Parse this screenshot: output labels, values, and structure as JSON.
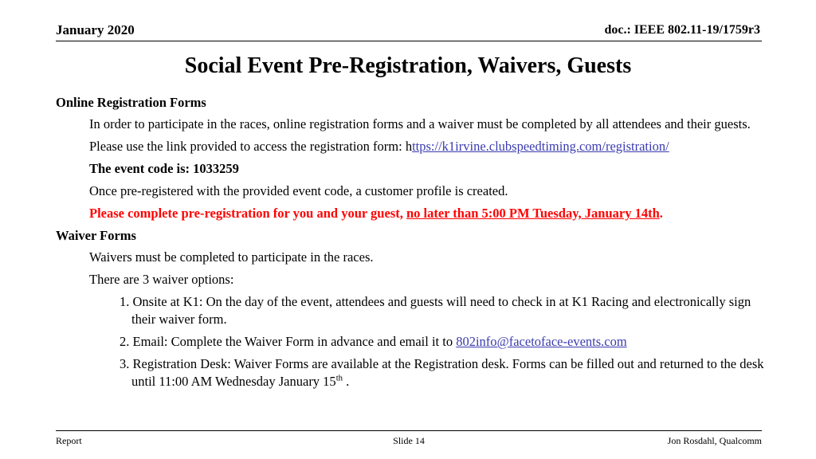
{
  "header": {
    "date": "January 2020",
    "doc": "doc.: IEEE 802.11-19/1759r3"
  },
  "title": "Social Event Pre-Registration, Waivers, Guests",
  "sections": [
    {
      "heading": "Online Registration Forms",
      "paragraphs": [
        "In order to participate in the races, online registration forms and a waiver must be completed by all attendees and their guests.",
        "Please use the link provided to access the registration form: ",
        "The event code is: 1033259",
        "Once pre-registered with the provided event code, a customer profile is created."
      ]
    },
    {
      "heading": "Waiver Forms",
      "paragraphs": [
        "Waivers must be completed to participate in the races.",
        "There are 3 waiver options:"
      ]
    }
  ],
  "registration": {
    "link_prefix_char": "h",
    "link_text": "ttps://k1irvine.clubspeedtiming.com/registration/",
    "link_color": "#3b3bb0"
  },
  "warning": {
    "lead": "Please complete pre-registration for you and your guest, ",
    "underlined": "no later than 5:00 PM Tuesday, January 14th",
    "trailing": ".",
    "color": "#FF0000"
  },
  "waiver_options": [
    {
      "number": "1.",
      "text": "Onsite at K1: On the day of the event, attendees and guests will need to check in at K1 Racing and electronically sign their waiver form."
    },
    {
      "number": "2.",
      "text_before": "Email: Complete the Waiver Form in advance and email it to ",
      "email": "802info@facetoface-events.com"
    },
    {
      "number": "3.",
      "text_before": "Registration Desk: Waiver Forms are available at the Registration desk.  Forms can be filled out and returned to the desk until 11:00 AM Wednesday January 15",
      "superscript": "th",
      "text_after": " ."
    }
  ],
  "footer": {
    "left": "Report",
    "center": "Slide 14",
    "right": "Jon Rosdahl, Qualcomm"
  }
}
